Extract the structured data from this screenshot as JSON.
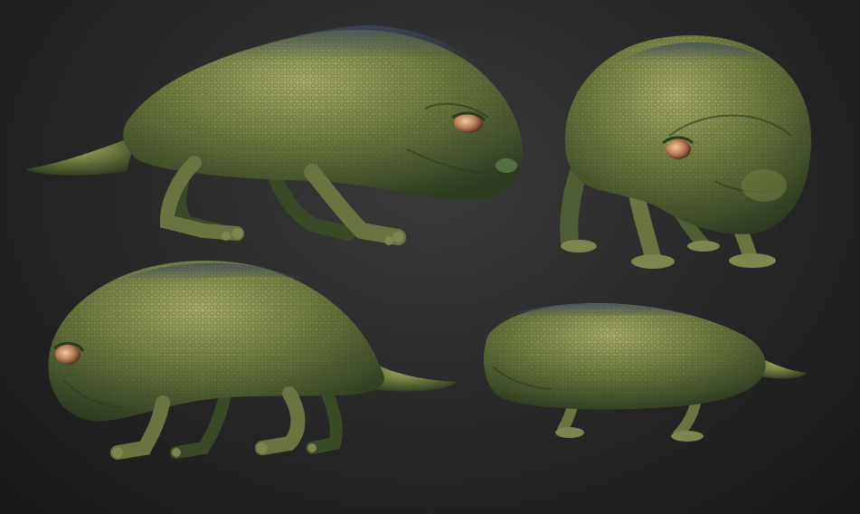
{
  "scene": {
    "background_color": "#262626",
    "skin_base": "#6f7b3f",
    "skin_shadow": "#2f3f22",
    "skin_highlight": "#a3a867",
    "back_tint": "#3e4a5e",
    "eye_color": "#c08a60"
  },
  "views": [
    {
      "id": "view-side-left",
      "description_label": ""
    },
    {
      "id": "view-front-three-quarter",
      "description_label": ""
    },
    {
      "id": "view-side-right",
      "description_label": ""
    },
    {
      "id": "view-rear-low",
      "description_label": ""
    }
  ]
}
